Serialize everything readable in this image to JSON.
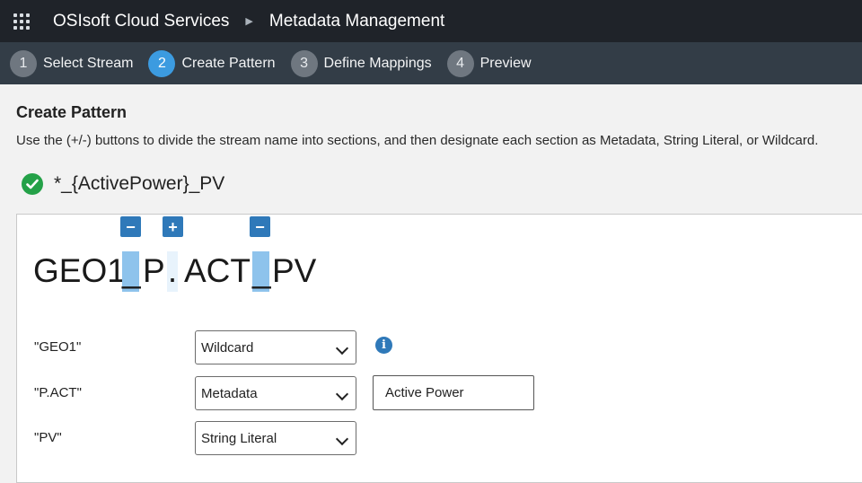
{
  "header": {
    "brand": "OSIsoft Cloud Services",
    "page_title": "Metadata Management"
  },
  "steps": [
    {
      "num": "1",
      "label": "Select Stream",
      "active": false
    },
    {
      "num": "2",
      "label": "Create Pattern",
      "active": true
    },
    {
      "num": "3",
      "label": "Define Mappings",
      "active": false
    },
    {
      "num": "4",
      "label": "Preview",
      "active": false
    }
  ],
  "main": {
    "heading": "Create Pattern",
    "description": "Use the (+/-) buttons to divide the stream name into sections, and then designate each section as Metadata, String Literal, or Wildcard.",
    "pattern": "*_{ActivePower}_PV"
  },
  "stream": {
    "segments": [
      "GEO1",
      "P",
      "ACT",
      "PV"
    ],
    "separators": [
      "_",
      ".",
      "_"
    ],
    "buttons": [
      "−",
      "+",
      "−"
    ]
  },
  "sections": [
    {
      "label": "\"GEO1\"",
      "type": "Wildcard"
    },
    {
      "label": "\"P.ACT\"",
      "type": "Metadata",
      "value": "Active Power"
    },
    {
      "label": "\"PV\"",
      "type": "String Literal"
    }
  ],
  "colors": {
    "topbar": "#1f2329",
    "stepsbar": "#333d47",
    "accent": "#3c9be0",
    "button": "#2f79b9",
    "success": "#24a148"
  }
}
